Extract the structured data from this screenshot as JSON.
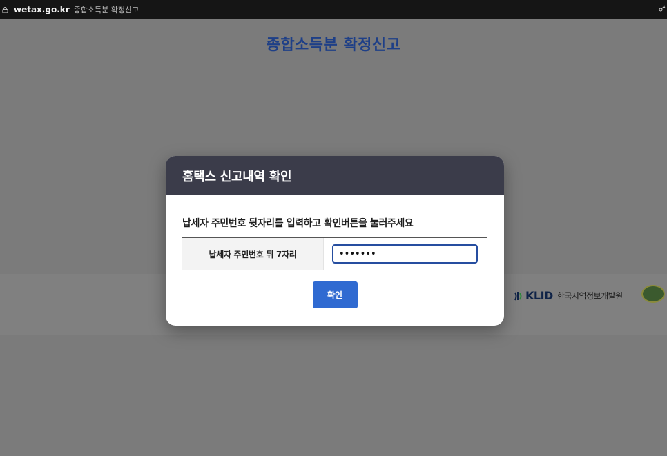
{
  "browser": {
    "domain": "wetax.go.kr",
    "tab_title": "종합소득분 확정신고"
  },
  "page": {
    "heading": "종합소득분 확정신고",
    "footer": {
      "klid_logo_text": "KLID",
      "klid_org_name": "한국지역정보개발원"
    }
  },
  "modal": {
    "title": "홈택스 신고내역 확인",
    "instruction": "납세자 주민번호 뒷자리를 입력하고 확인버튼을 눌러주세요",
    "field_label": "납세자 주민번호 뒤 7자리",
    "field_value": "•••••••",
    "confirm_label": "확인"
  },
  "colors": {
    "heading": "#1e3f87",
    "modal_header": "#3b3c4a",
    "confirm_button": "#2f6ad1",
    "input_border": "#264ea0"
  }
}
